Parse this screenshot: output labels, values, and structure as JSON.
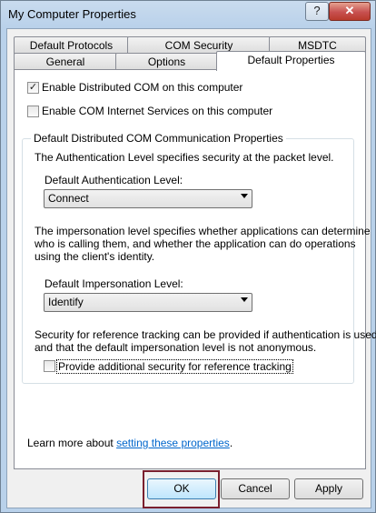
{
  "window": {
    "title": "My Computer Properties",
    "help_glyph": "?",
    "close_glyph": "✕"
  },
  "tabs": {
    "row1": [
      "Default Protocols",
      "COM Security",
      "MSDTC"
    ],
    "row2": [
      "General",
      "Options",
      "Default Properties"
    ],
    "active": "Default Properties"
  },
  "options": {
    "enable_dcom": {
      "label": "Enable Distributed COM on this computer",
      "checked": true
    },
    "enable_cis": {
      "label": "Enable COM Internet Services on this computer",
      "checked": false
    }
  },
  "group": {
    "title": "Default Distributed COM Communication Properties",
    "auth_desc": "The Authentication Level specifies security at the packet level.",
    "auth_label": "Default Authentication Level:",
    "auth_value": "Connect",
    "imp_desc_1": "The impersonation level specifies whether applications can determine",
    "imp_desc_2": "who is calling them, and whether the application can do operations",
    "imp_desc_3": "using the client's identity.",
    "imp_label": "Default Impersonation Level:",
    "imp_value": "Identify",
    "ref_desc_1": "Security for reference tracking can be provided if authentication is used",
    "ref_desc_2": "and that the default impersonation level is not anonymous.",
    "ref_checkbox": {
      "label": "Provide additional security for reference tracking",
      "checked": false
    }
  },
  "learn": {
    "prefix": "Learn more about ",
    "link": "setting these properties",
    "suffix": "."
  },
  "buttons": {
    "ok": "OK",
    "cancel": "Cancel",
    "apply": "Apply"
  },
  "colors": {
    "link": "#0066cc",
    "highlight_border": "#7a1f2e"
  }
}
